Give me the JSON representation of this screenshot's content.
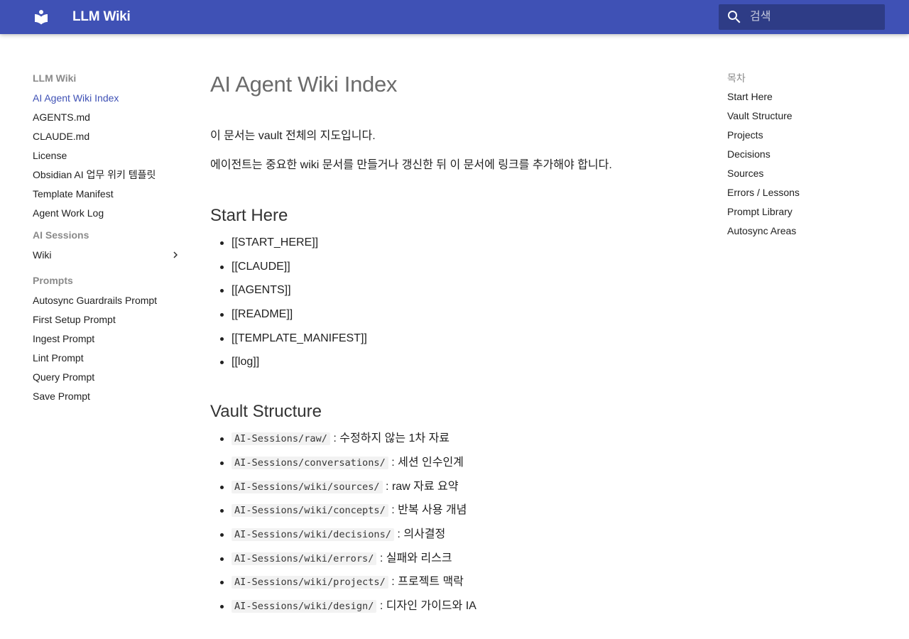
{
  "header": {
    "site_title": "LLM Wiki",
    "logo_icon": "book-icon",
    "search_placeholder": "검색",
    "search_value": "",
    "color": "#3f51b5"
  },
  "sidebar": {
    "section1_title": "LLM Wiki",
    "section1_items": [
      "AI Agent Wiki Index",
      "AGENTS.md",
      "CLAUDE.md",
      "License",
      "Obsidian AI 업무 위키 템플릿",
      "Template Manifest",
      "Agent Work Log"
    ],
    "active_item": "AI Agent Wiki Index",
    "section2_title": "AI Sessions",
    "section2_items": [
      "Wiki"
    ],
    "section3_title": "Prompts",
    "section3_items": [
      "Autosync Guardrails Prompt",
      "First Setup Prompt",
      "Ingest Prompt",
      "Lint Prompt",
      "Query Prompt",
      "Save Prompt"
    ]
  },
  "content": {
    "title": "AI Agent Wiki Index",
    "intro": [
      "이 문서는 vault 전체의 지도입니다.",
      "에이전트는 중요한 wiki 문서를 만들거나 갱신한 뒤 이 문서에 링크를 추가해야 합니다."
    ],
    "start_here": {
      "heading": "Start Here",
      "items": [
        "[[START_HERE]]",
        "[[CLAUDE]]",
        "[[AGENTS]]",
        "[[README]]",
        "[[TEMPLATE_MANIFEST]]",
        "[[log]]"
      ]
    },
    "vault_structure": {
      "heading": "Vault Structure",
      "items": [
        {
          "path": "AI-Sessions/raw/",
          "desc": " : 수정하지 않는 1차 자료"
        },
        {
          "path": "AI-Sessions/conversations/",
          "desc": " : 세션 인수인계"
        },
        {
          "path": "AI-Sessions/wiki/sources/",
          "desc": " : raw 자료 요약"
        },
        {
          "path": "AI-Sessions/wiki/concepts/",
          "desc": " : 반복 사용 개념"
        },
        {
          "path": "AI-Sessions/wiki/decisions/",
          "desc": " : 의사결정"
        },
        {
          "path": "AI-Sessions/wiki/errors/",
          "desc": " : 실패와 리스크"
        },
        {
          "path": "AI-Sessions/wiki/projects/",
          "desc": " : 프로젝트 맥락"
        },
        {
          "path": "AI-Sessions/wiki/design/",
          "desc": " : 디자인 가이드와 IA"
        }
      ]
    }
  },
  "toc": {
    "heading": "목차",
    "items": [
      "Start Here",
      "Vault Structure",
      "Projects",
      "Decisions",
      "Sources",
      "Errors / Lessons",
      "Prompt Library",
      "Autosync Areas"
    ]
  }
}
